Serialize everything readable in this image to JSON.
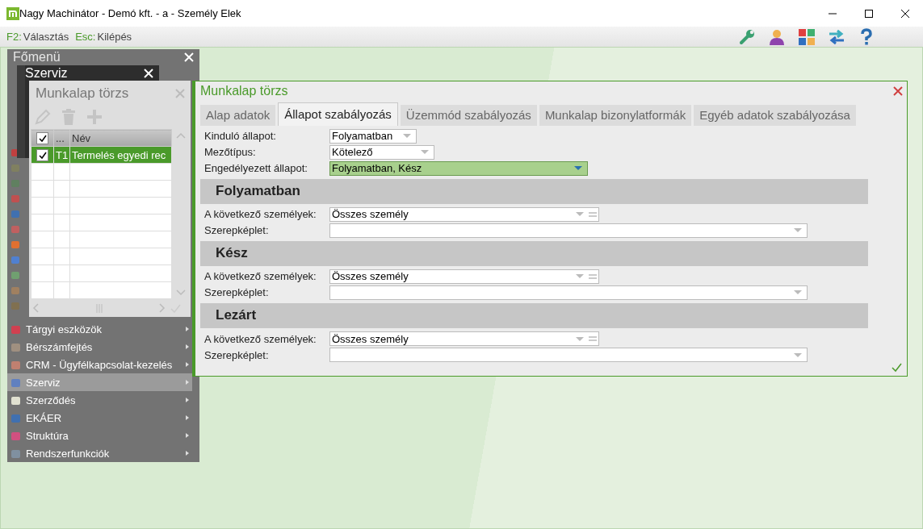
{
  "window": {
    "title": "Nagy Machinátor - Demó kft. - a - Személy Elek"
  },
  "toolbar": {
    "shortcuts": [
      {
        "key": "F2:",
        "label": "Választás"
      },
      {
        "key": "Esc:",
        "label": "Kilépés"
      }
    ]
  },
  "main_menu": {
    "title": "Főmenü",
    "items": [
      {
        "label": "Tárgyi eszközök",
        "selected": false
      },
      {
        "label": "Bérszámfejtés",
        "selected": false
      },
      {
        "label": "CRM - Ügyfélkapcsolat-kezelés",
        "selected": false
      },
      {
        "label": "Szerviz",
        "selected": true
      },
      {
        "label": "Szerződés",
        "selected": false
      },
      {
        "label": "EKÁER",
        "selected": false
      },
      {
        "label": "Struktúra",
        "selected": false
      },
      {
        "label": "Rendszerfunkciók",
        "selected": false
      }
    ]
  },
  "submenu": {
    "title": "Szerviz"
  },
  "list_window": {
    "title": "Munkalap törzs",
    "header_checked": true,
    "columns": [
      "...",
      "Név"
    ],
    "rows": [
      {
        "checked": true,
        "code": "T1",
        "name": "Termelés egyedi rec",
        "selected": true
      }
    ]
  },
  "form_window": {
    "title": "Munkalap törzs",
    "tabs": [
      {
        "label": "Alap adatok",
        "selected": false
      },
      {
        "label": "Állapot szabályozás",
        "selected": true
      },
      {
        "label": "Üzemmód szabályozás",
        "selected": false
      },
      {
        "label": "Munkalap bizonylatformák",
        "selected": false
      },
      {
        "label": "Egyéb adatok szabályozása",
        "selected": false
      }
    ],
    "fields": [
      {
        "label": "Kinduló állapot:",
        "value": "Folyamatban",
        "highlighted": false
      },
      {
        "label": "Mezőtípus:",
        "value": "Kötelező",
        "highlighted": false
      },
      {
        "label": "Engedélyezett állapot:",
        "value": "Folyamatban, Kész",
        "highlighted": true
      }
    ],
    "sections": [
      {
        "title": "Folyamatban",
        "fields": [
          {
            "kind": "multi",
            "label": "A következő személyek:",
            "value": "Összes személy"
          },
          {
            "kind": "dropdown",
            "label": "Szerepképlet:"
          }
        ]
      },
      {
        "title": "Kész",
        "fields": [
          {
            "kind": "multi",
            "label": "A következő személyek:",
            "value": "Összes személy"
          },
          {
            "kind": "dropdown",
            "label": "Szerepképlet:"
          }
        ]
      },
      {
        "title": "Lezárt",
        "fields": [
          {
            "kind": "multi",
            "label": "A következő személyek:",
            "value": "Összes személy"
          },
          {
            "kind": "dropdown",
            "label": "Szerepképlet:"
          }
        ]
      }
    ]
  }
}
